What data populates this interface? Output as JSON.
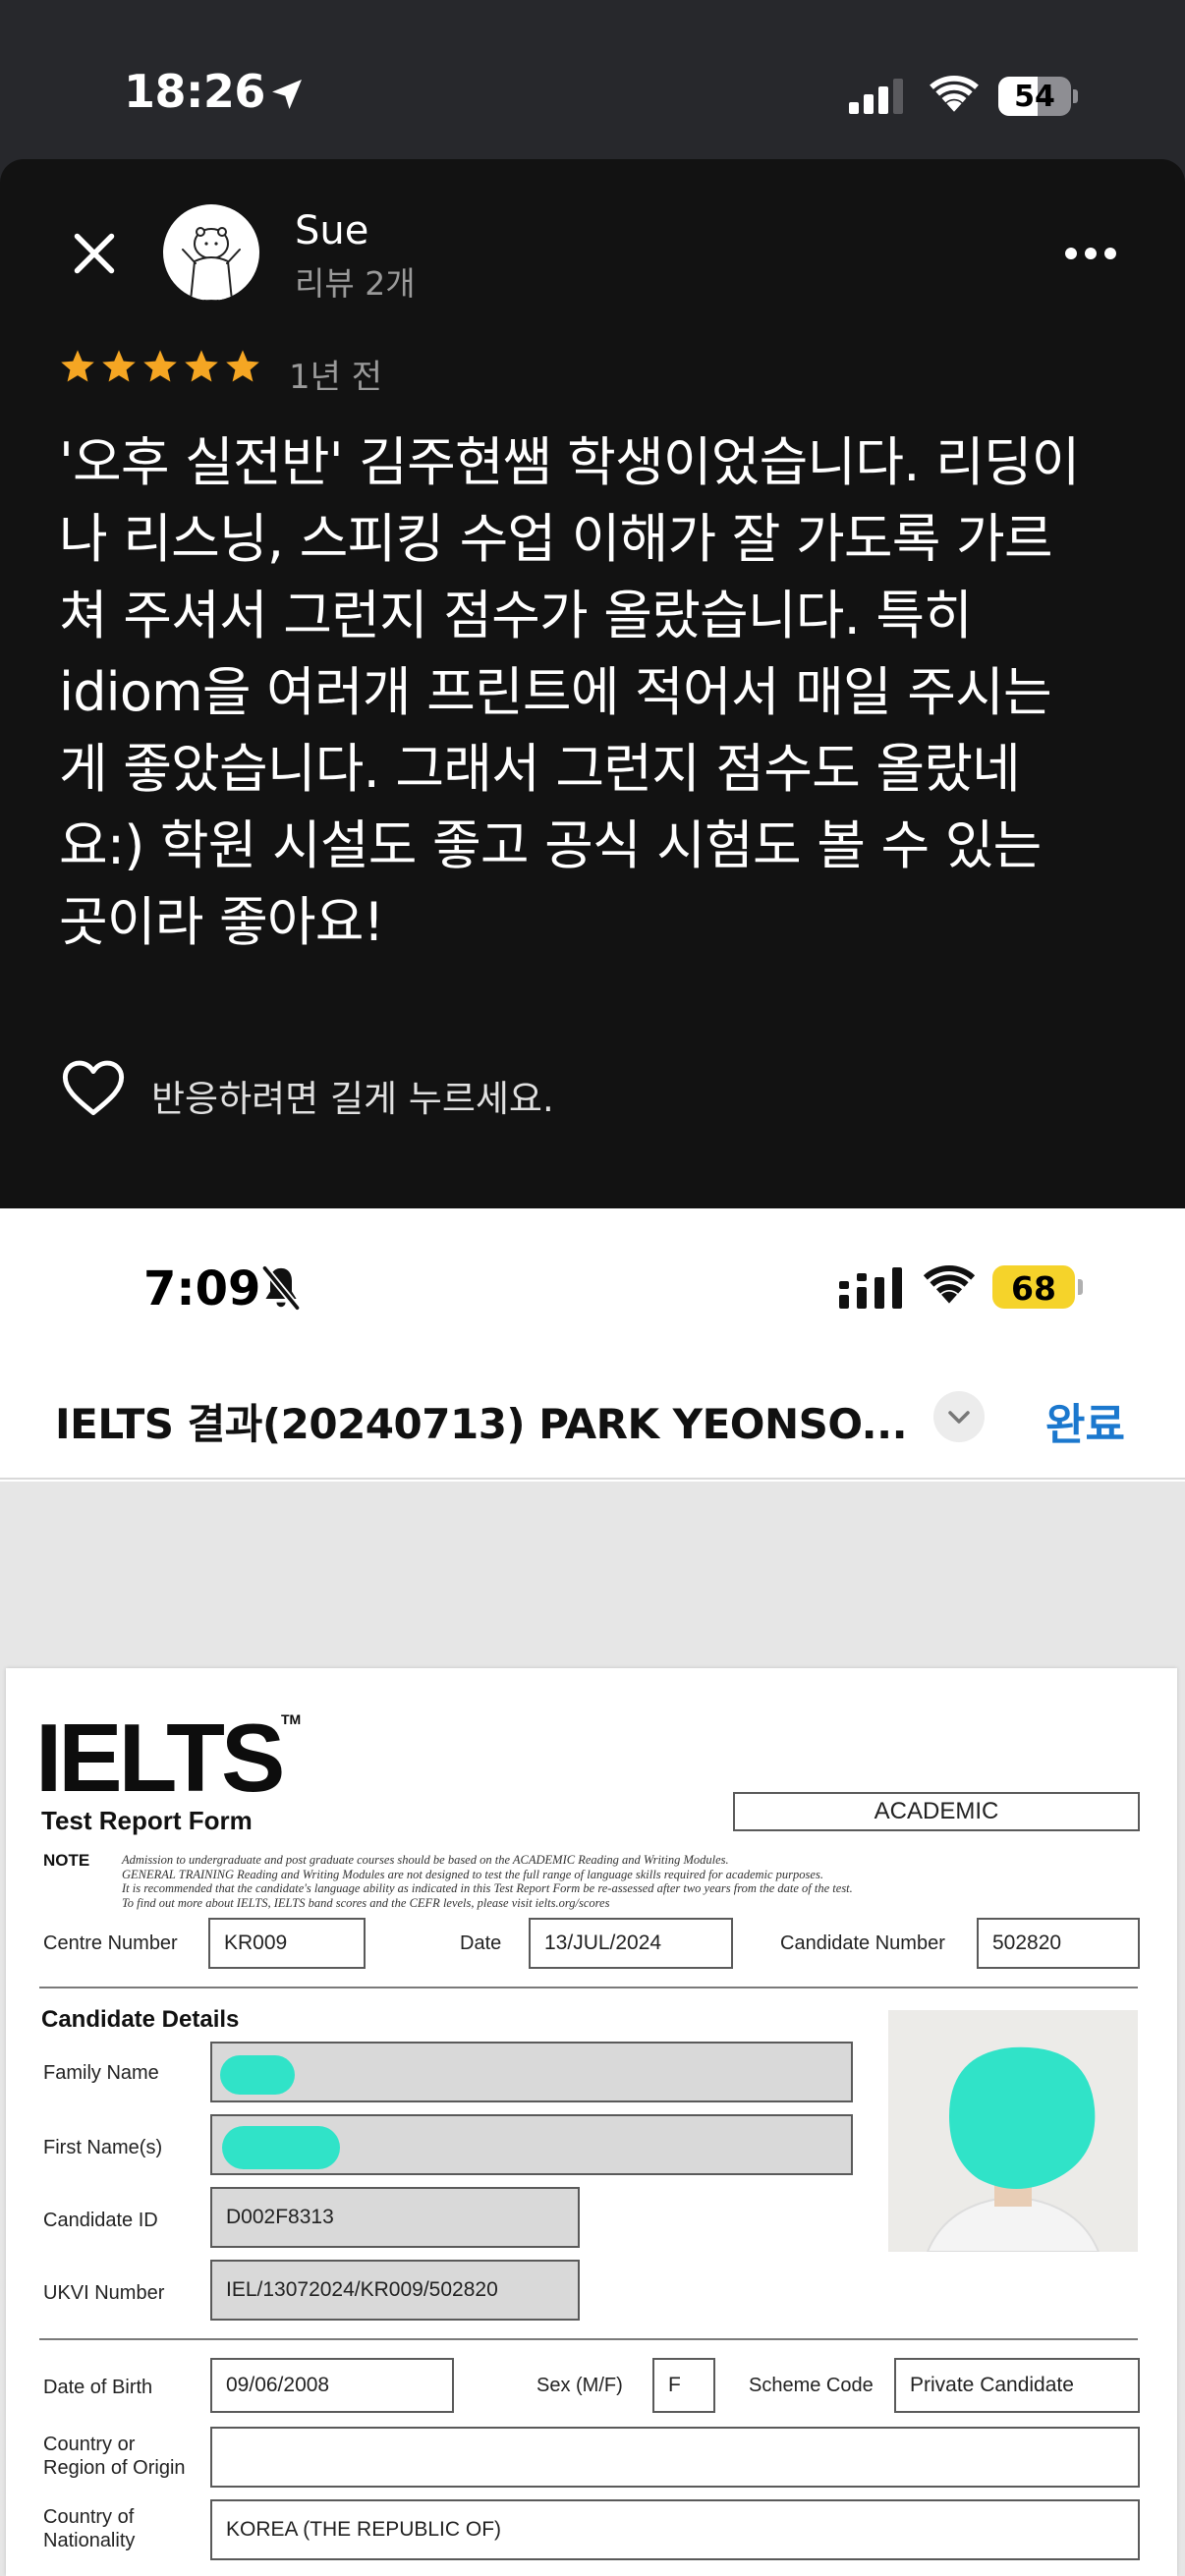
{
  "top": {
    "status_bar": {
      "time": "18:26",
      "battery": "54",
      "battery_level_pct": 54
    },
    "review": {
      "user_name": "Sue",
      "review_count": "리뷰 2개",
      "rating": 5,
      "time_ago": "1년 전",
      "text": "'오후 실전반' 김주현쌤 학생이었습니다. 리딩이\n나 리스닝, 스피킹 수업 이해가 잘 가도록 가르\n쳐 주셔서 그런지 점수가 올랐습니다. 특히\nidiom을 여러개 프린트에 적어서 매일 주시는\n게 좋았습니다. 그래서 그런지 점수도 올랐네\n요:) 학원 시설도 좋고 공식 시험도 볼 수 있는\n곳이라 좋아요!",
      "reaction_hint": "반응하려면 길게 누르세요."
    },
    "icons": [
      "location-arrow-icon",
      "signal-icon",
      "wifi-icon",
      "battery-icon",
      "close-icon",
      "avatar",
      "more-icon",
      "star-icon",
      "heart-icon"
    ]
  },
  "bottom": {
    "status_bar": {
      "time": "7:09",
      "battery": "68",
      "battery_color": "#f5d32a"
    },
    "nav": {
      "title": "IELTS 결과(20240713) PARK YEONSO...",
      "done_label": "완료",
      "done_color": "#1b78ce"
    },
    "form": {
      "logo": "IELTS",
      "tm": "TM",
      "form_title": "Test Report Form",
      "module": "ACADEMIC",
      "note_label": "NOTE",
      "note_text": "Admission to undergraduate and post graduate courses should be based on the ACADEMIC Reading and Writing Modules.\nGENERAL TRAINING Reading and Writing Modules are not designed to test the full range of language skills required for academic purposes.\nIt is recommended that the candidate's language ability as indicated in this Test Report Form be re-assessed after two years from the date of the test.\nTo find out more about IELTS, IELTS band scores and the CEFR levels, please visit ielts.org/scores",
      "centre_number_label": "Centre Number",
      "centre_number": "KR009",
      "date_label": "Date",
      "date": "13/JUL/2024",
      "candidate_number_label": "Candidate Number",
      "candidate_number": "502820",
      "candidate_details_title": "Candidate Details",
      "family_name_label": "Family Name",
      "first_names_label": "First Name(s)",
      "candidate_id_label": "Candidate ID",
      "candidate_id": "D002F8313",
      "ukvi_label": "UKVI Number",
      "ukvi_number": "IEL/13072024/KR009/502820",
      "dob_label": "Date of Birth",
      "dob": "09/06/2008",
      "sex_label": "Sex (M/F)",
      "sex": "F",
      "scheme_label": "Scheme Code",
      "scheme": "Private Candidate",
      "origin_label": "Country or\nRegion of Origin",
      "nationality_label": "Country of\nNationality",
      "nationality": "KOREA (THE REPUBLIC OF)",
      "redaction_color": "#30e3c8"
    },
    "icons": [
      "bell-off-icon",
      "signal-icon",
      "wifi-icon",
      "battery-icon",
      "chevron-down-icon"
    ]
  }
}
